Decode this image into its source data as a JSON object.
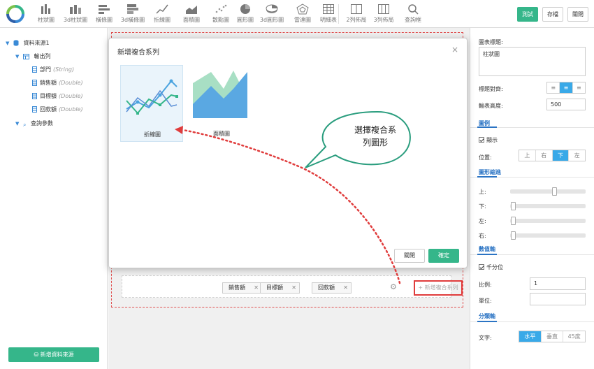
{
  "toolbar": {
    "items": [
      {
        "label": "柱狀圖",
        "icon": "bar-chart-icon"
      },
      {
        "label": "3d柱狀圖",
        "icon": "bar-3d-icon"
      },
      {
        "label": "橫條圖",
        "icon": "horizontal-bar-icon"
      },
      {
        "label": "3d橫條圖",
        "icon": "horizontal-bar-3d-icon"
      },
      {
        "label": "折線圖",
        "icon": "line-chart-icon"
      },
      {
        "label": "面積圖",
        "icon": "area-chart-icon"
      },
      {
        "label": "散點圖",
        "icon": "scatter-icon"
      },
      {
        "label": "圓形圖",
        "icon": "pie-icon"
      },
      {
        "label": "3d圓形圖",
        "icon": "pie-3d-icon"
      },
      {
        "label": "雷達圖",
        "icon": "radar-icon"
      },
      {
        "label": "明細表",
        "icon": "table-icon"
      },
      {
        "label": "2列佈局",
        "icon": "two-column-icon"
      },
      {
        "label": "3列佈局",
        "icon": "three-column-icon"
      },
      {
        "label": "查詢框",
        "icon": "search-icon"
      }
    ],
    "test_label": "測試",
    "save_label": "存檔",
    "close_label": "關閉"
  },
  "tree": {
    "datasource": "資料來源1",
    "output": "輸出列",
    "fields": [
      {
        "name": "部門",
        "type": "(String)"
      },
      {
        "name": "銷售額",
        "type": "(Double)"
      },
      {
        "name": "目標額",
        "type": "(Double)"
      },
      {
        "name": "回款額",
        "type": "(Double)"
      }
    ],
    "query_params": "查詢參數",
    "add_datasource": "新增資料來源"
  },
  "series": {
    "tags": [
      "銷售額",
      "目標額",
      "回款額"
    ],
    "tag_close": "✕",
    "add_combo": "+ 新增複合系列"
  },
  "modal": {
    "title": "新增複合系列",
    "close_glyph": "×",
    "options": [
      {
        "label": "折線圖",
        "selected": true
      },
      {
        "label": "面積圖",
        "selected": false
      }
    ],
    "close_button": "關閉",
    "ok_button": "確定"
  },
  "callout": {
    "line1": "選擇複合系",
    "line2": "列圖形"
  },
  "props": {
    "chart_title_label": "圖表標題:",
    "chart_title_value": "柱狀圖",
    "title_align_label": "標題對齊:",
    "align_options": [
      "≡",
      "≡",
      "≡"
    ],
    "height_label": "輸表高度:",
    "height_value": "500",
    "legend_section": "圖例",
    "legend_show": "顯示",
    "position_label": "位置:",
    "position_options": [
      "上",
      "右",
      "下",
      "左"
    ],
    "position_selected": "下",
    "indent_section": "圖形縮進",
    "indent_labels": [
      "上:",
      "下:",
      "左:",
      "右:"
    ],
    "indent_values": [
      0.6,
      0,
      0,
      0
    ],
    "value_axis_section": "數值軸",
    "thousands": "千分位",
    "ratio_label": "比例:",
    "ratio_value": "1",
    "unit_label": "單位:",
    "unit_value": "",
    "category_axis_section": "分類軸",
    "text_label": "文字:",
    "text_options": [
      "水平",
      "垂直",
      "45度"
    ],
    "text_selected": "水平"
  },
  "colors": {
    "accent_green": "#35b68a",
    "accent_blue": "#39a9e8",
    "highlight_red": "#e03c3c",
    "callout_border": "#2a9d7e"
  }
}
